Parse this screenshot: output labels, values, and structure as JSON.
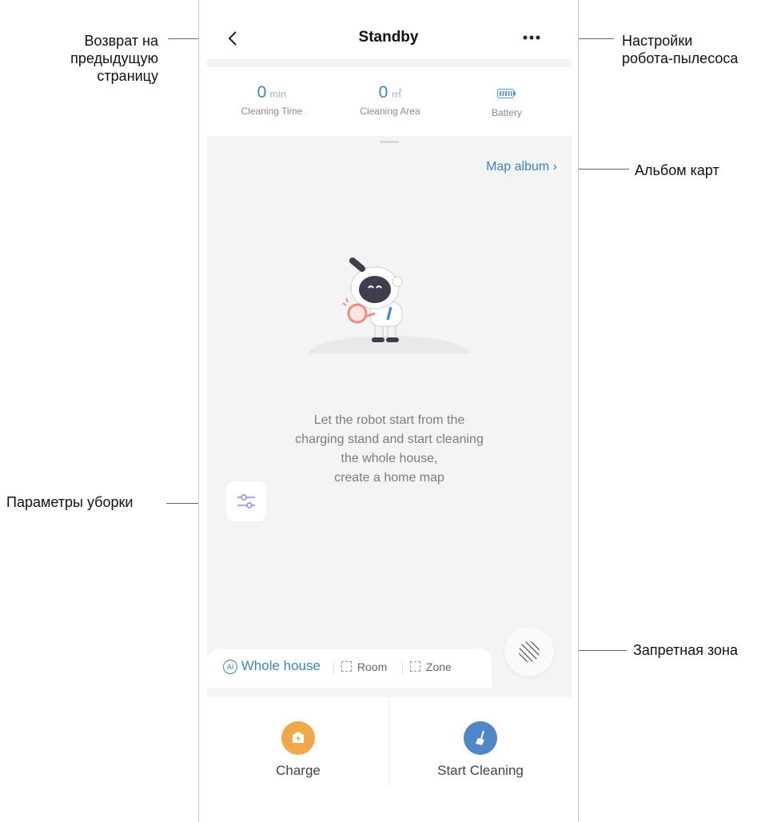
{
  "annotations": {
    "back": "Возврат на предыдущую страницу",
    "back_lines": [
      "Возврат на",
      "предыдущую",
      "страницу"
    ],
    "settings_lines": [
      "Настройки",
      "робота-пылесоса"
    ],
    "map_album": "Альбом карт",
    "clean_params": "Параметры уборки",
    "nogo": "Запретная зона"
  },
  "header": {
    "title": "Standby"
  },
  "stats": [
    {
      "value": "0",
      "unit": "min",
      "label": "Cleaning Time"
    },
    {
      "value": "0",
      "unit": "㎡",
      "label": "Cleaning Area"
    },
    {
      "label": "Battery",
      "icon": "battery-icon"
    }
  ],
  "map": {
    "album_label": "Map album",
    "hint_lines": [
      "Let the robot start from the",
      "charging stand and start cleaning",
      "the whole house,",
      "create a home map"
    ]
  },
  "modes": [
    {
      "label": "Whole house",
      "icon": "ai-icon",
      "active": true
    },
    {
      "label": "Room",
      "icon": "room-icon",
      "active": false
    },
    {
      "label": "Zone",
      "icon": "zone-icon",
      "active": false
    }
  ],
  "actions": {
    "charge_label": "Charge",
    "start_label": "Start Cleaning"
  },
  "colors": {
    "accent": "#3a86c8",
    "charge": "#f0a94a",
    "start": "#4f86c8"
  }
}
